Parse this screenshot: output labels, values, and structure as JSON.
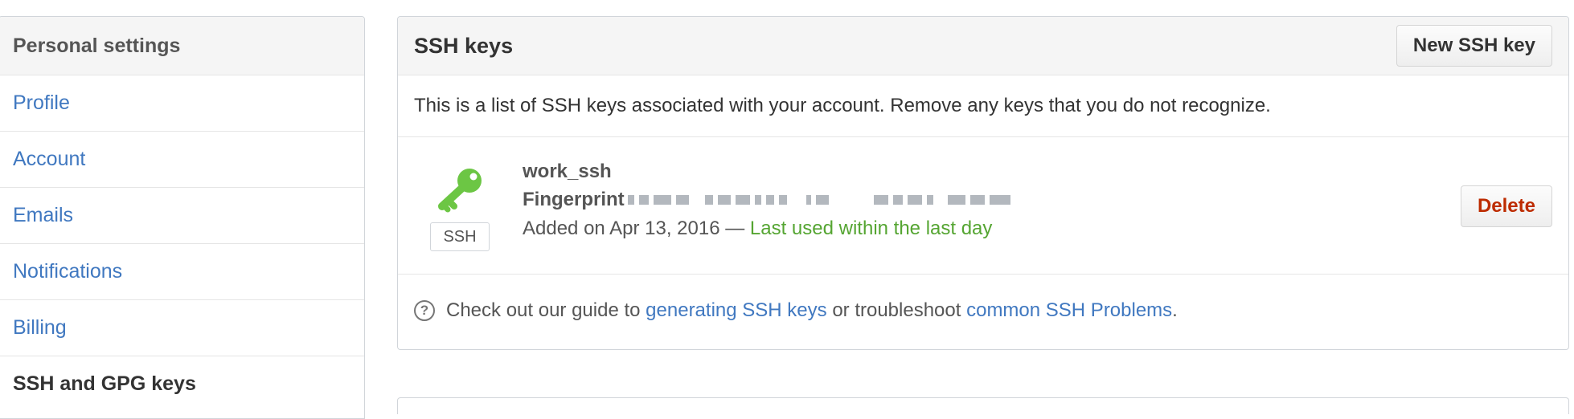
{
  "sidebar": {
    "header": "Personal settings",
    "items": [
      {
        "label": "Profile"
      },
      {
        "label": "Account"
      },
      {
        "label": "Emails"
      },
      {
        "label": "Notifications"
      },
      {
        "label": "Billing"
      },
      {
        "label": "SSH and GPG keys",
        "selected": true
      }
    ]
  },
  "panel": {
    "title": "SSH keys",
    "new_key_button": "New SSH key",
    "intro": "This is a list of SSH keys associated with your account. Remove any keys that you do not recognize.",
    "key": {
      "badge": "SSH",
      "title": "work_ssh",
      "fingerprint_label": "Fingerprint",
      "added_text": "Added on Apr 13, 2016 —",
      "last_used": "Last used within the last day",
      "delete_button": "Delete",
      "icon": "key-icon",
      "icon_color": "#6cc644"
    },
    "footer": {
      "icon": "question-icon",
      "prefix": "Check out our guide to",
      "link1": "generating SSH keys",
      "middle": "or troubleshoot",
      "link2": "common SSH Problems",
      "suffix": "."
    }
  },
  "colors": {
    "link": "#4078c0",
    "success": "#55a532",
    "danger": "#bd2c00"
  }
}
